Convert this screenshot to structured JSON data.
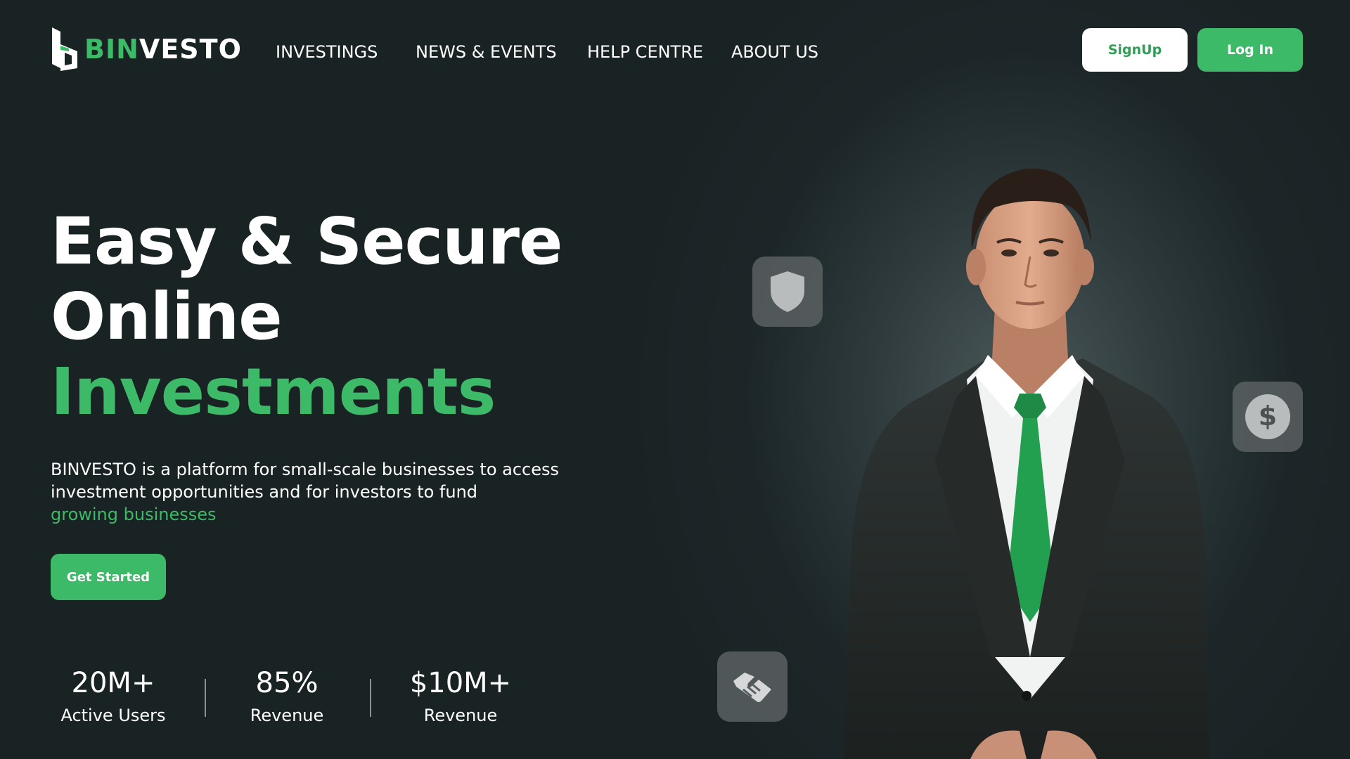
{
  "brand": {
    "prefix": "BIN",
    "suffix": "VESTO"
  },
  "nav": {
    "items": [
      {
        "label": "INVESTINGS"
      },
      {
        "label": "NEWS & EVENTS"
      },
      {
        "label": "HELP CENTRE"
      },
      {
        "label": "ABOUT US"
      }
    ]
  },
  "auth": {
    "signup_label": "SignUp",
    "login_label": "Log In"
  },
  "hero": {
    "title_line1": "Easy & Secure",
    "title_line2": "Online",
    "title_line3": "Investments",
    "description": "BINVESTO is a platform for small-scale businesses to access investment opportunities and for investors to fund",
    "description_highlight": "growing businesses",
    "cta_label": "Get Started"
  },
  "stats": [
    {
      "value": "20M+",
      "label": "Active Users"
    },
    {
      "value": "85%",
      "label": "Revenue"
    },
    {
      "value": "$10M+",
      "label": "Revenue"
    }
  ],
  "floating_icons": [
    "shield-icon",
    "dollar-icon",
    "handshake-icon"
  ],
  "colors": {
    "background": "#1a2324",
    "accent": "#3dba67",
    "text": "#ffffff",
    "tile": "#5a6062"
  }
}
